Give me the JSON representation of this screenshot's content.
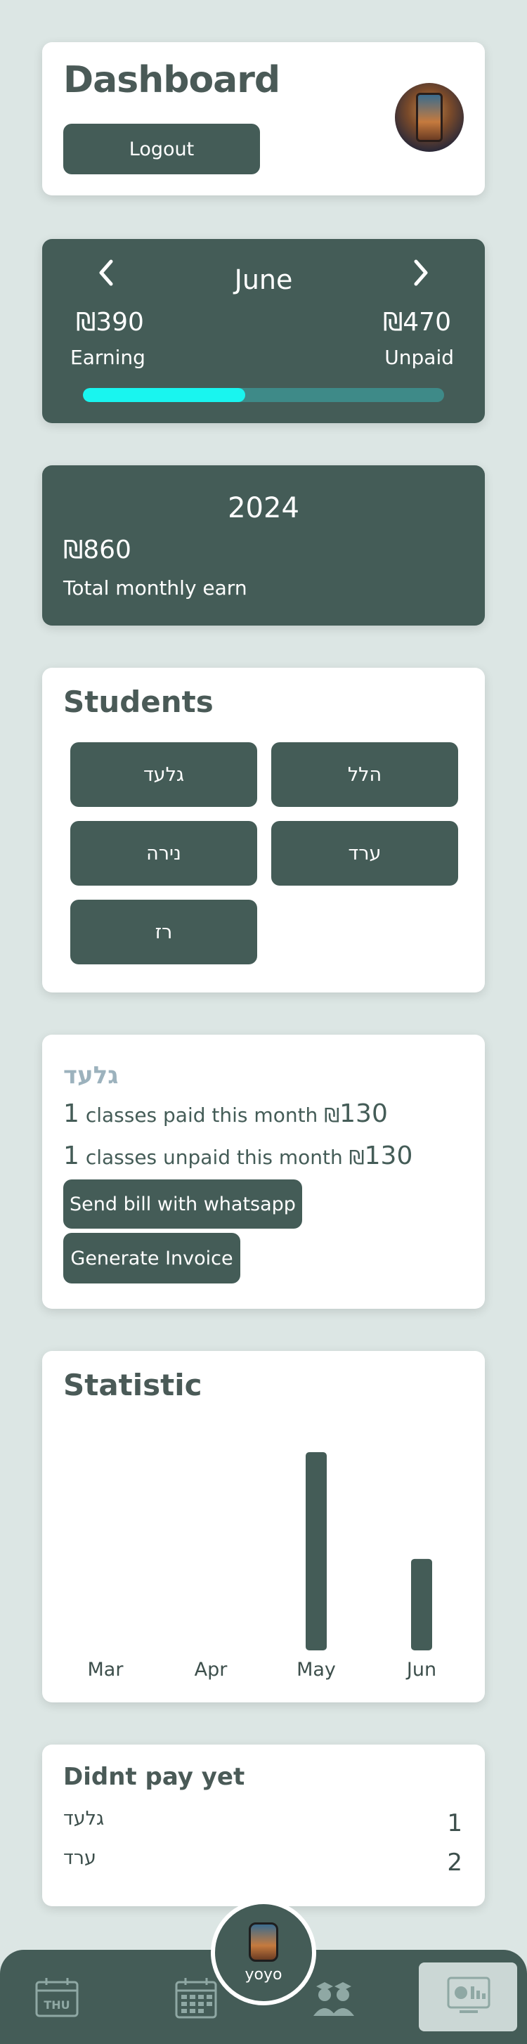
{
  "header": {
    "title": "Dashboard",
    "logout_label": "Logout"
  },
  "month_card": {
    "month": "June",
    "earning_value": "₪390",
    "earning_label": "Earning",
    "unpaid_value": "₪470",
    "unpaid_label": "Unpaid",
    "paid_fraction": 0.45
  },
  "year_card": {
    "year": "2024",
    "total_value": "₪860",
    "total_label": "Total monthly earn"
  },
  "students": {
    "title": "Students",
    "items": [
      "גלעד",
      "הלל",
      "נירה",
      "ערד",
      "רז"
    ]
  },
  "selected_student": {
    "name": "גלעד",
    "paid_count": "1",
    "paid_text": "classes paid this month ₪",
    "paid_amount": "130",
    "unpaid_count": "1",
    "unpaid_text": "classes unpaid this month ₪",
    "unpaid_amount": "130",
    "whatsapp_label": "Send bill with whatsapp",
    "invoice_label": "Generate Invoice"
  },
  "statistic": {
    "title": "Statistic"
  },
  "chart_data": {
    "type": "bar",
    "categories": [
      "Mar",
      "Apr",
      "May",
      "Jun"
    ],
    "values": [
      0,
      0,
      390,
      180
    ],
    "title": "Statistic",
    "xlabel": "",
    "ylabel": "",
    "ylim": [
      0,
      390
    ],
    "grid": false,
    "color": "#445c57"
  },
  "didnt_pay": {
    "title": "Didnt pay yet",
    "rows": [
      {
        "name": "גלעד",
        "count": "1"
      },
      {
        "name": "ערד",
        "count": "2"
      }
    ]
  },
  "nav": {
    "user_name": "yoyo",
    "day_label": "THU",
    "icons": [
      "calendar-day-icon",
      "calendar-grid-icon",
      "user-avatar-icon",
      "students-icon",
      "dashboard-icon"
    ],
    "active": "dashboard-icon"
  }
}
